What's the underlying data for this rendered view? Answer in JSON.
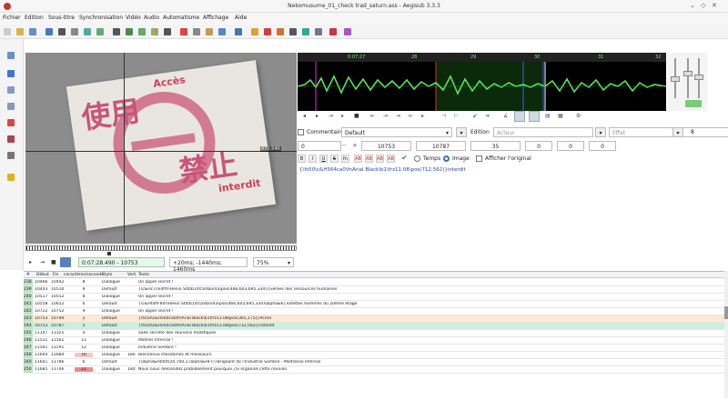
{
  "window": {
    "title": "Nekomusume_01_check trad_saturn.ass - Aegisub 3.3.3"
  },
  "menu": [
    "Fichier",
    "Edition",
    "Sous-titre",
    "Synchronisation",
    "Vidéo",
    "Audio",
    "Automatisme",
    "Affichage",
    "Aide"
  ],
  "video": {
    "kanji_top": "使用",
    "kanji_bottom": "禁止",
    "label_top": "Accès",
    "label_bottom": "interdit",
    "coords": "870,540"
  },
  "video_controls": {
    "time": "0:07:28.490 - 10753",
    "offset": "+20ms; -1440ms; 1460ms",
    "zoom": "75%"
  },
  "audio": {
    "ticks": [
      "0:07:27",
      "28",
      "29",
      "30",
      "31",
      "32"
    ]
  },
  "editor": {
    "comment_label": "Commentaire",
    "style": "Default",
    "edit_label": "Edition",
    "actor_placeholder": "Acteur",
    "effect_placeholder": "Effet",
    "margin_v": "8",
    "layer": "0",
    "start_frame": "10753",
    "end_frame": "10787",
    "duration": "35",
    "margin_l": "0",
    "margin_r": "0",
    "margin_v2": "0",
    "format_buttons": [
      "B",
      "I",
      "U",
      "S",
      "fn",
      "AB",
      "AB",
      "AB",
      "AB"
    ],
    "radio_time": "Temps",
    "radio_image": "Image",
    "show_original": "Afficher l'original",
    "text": "{\\fs50\\c&H564ca0\\fnArial Black\\b1\\frz11.08\\pos(712,562)}interdit"
  },
  "grid": {
    "headers": [
      "#",
      "Début",
      "Fin",
      "caractères/seconde",
      "Style",
      "Vert.",
      "Texte"
    ],
    "rows": [
      {
        "n": "238",
        "start": "10466",
        "end": "10442",
        "cps": "8",
        "style": "Dialogue",
        "vert": "",
        "text": "Un appel secret !"
      },
      {
        "n": "239",
        "start": "10443",
        "end": "10510",
        "cps": "9",
        "style": "Default",
        "vert": "",
        "text": "{\\c&Hc7ce4f\\fnHelvo Std\\b1\\fs50\\bord3\\pos(466,603,695,334)}Gérées des ressources humaines"
      },
      {
        "n": "240",
        "start": "10517",
        "end": "10552",
        "cps": "8",
        "style": "Dialogue",
        "vert": "",
        "text": "Un appel secret !"
      },
      {
        "n": "241",
        "start": "10558",
        "end": "10652",
        "cps": "6",
        "style": "Default",
        "vert": "",
        "text": "{\\c&HfaffF8\\fnHelvo Std\\b1\\fs50\\bord3\\pos(466,603,695,334)\\alpha&6}Toilettes hommes du 20ème étage"
      },
      {
        "n": "242",
        "start": "10722",
        "end": "10752",
        "cps": "9",
        "style": "Dialogue",
        "vert": "",
        "text": "Un appel secret !"
      },
      {
        "n": "243",
        "start": "10753",
        "end": "10794",
        "cps": "2",
        "style": "Default",
        "vert": "",
        "text": "{\\fs50\\c&H564ca0\\fnArial Black\\b1\\frz11.08\\pos(365,175)}Accès"
      },
      {
        "n": "244",
        "start": "10753",
        "end": "10787",
        "cps": "5",
        "style": "Default",
        "vert": "",
        "text": "{\\fs50\\c&H564ca0\\fnArial Black\\b1\\frz11.08\\pos(712,562)}interdit"
      },
      {
        "n": "245",
        "start": "11147",
        "end": "11325",
        "cps": "4",
        "style": "Dialogue",
        "vert": "",
        "text": "Salle secrète des réunions maléfiques"
      },
      {
        "n": "246",
        "start": "11531",
        "end": "11561",
        "cps": "11",
        "style": "Dialogue",
        "vert": "",
        "text": "Maîtres Infernal !"
      },
      {
        "n": "247",
        "start": "11561",
        "end": "11591",
        "cps": "12",
        "style": "Dialogue",
        "vert": "",
        "text": "Industrie Sombre !"
      },
      {
        "n": "248",
        "start": "11644",
        "end": "11684",
        "cps": "16",
        "style": "Dialogue",
        "vert": "180",
        "text": "Bienvenue mesdames et messieurs."
      },
      {
        "n": "249",
        "start": "11641",
        "end": "11786",
        "cps": "6",
        "style": "Default",
        "vert": "",
        "text": "{\\alpha&H00\\t(20,700,1,\\alpha&HFF)}Brigeant de l'Industrie Sombre - Maîtresse Infernal"
      },
      {
        "n": "250",
        "start": "11685",
        "end": "11746",
        "cps": "22",
        "style": "Dialogue",
        "vert": "180",
        "text": "Nous nous demandez probablement pourquoi j'ai organisé cette réunion."
      }
    ]
  }
}
